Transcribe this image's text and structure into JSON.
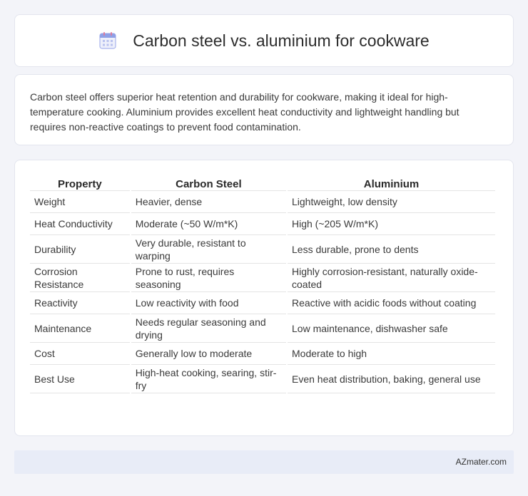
{
  "header": {
    "title": "Carbon steel vs. aluminium for cookware",
    "icon": "calendar-icon"
  },
  "summary": {
    "text": "Carbon steel offers superior heat retention and durability for cookware, making it ideal for high-temperature cooking. Aluminium provides excellent heat conductivity and lightweight handling but requires non-reactive coatings to prevent food contamination."
  },
  "table": {
    "headers": [
      "Property",
      "Carbon Steel",
      "Aluminium"
    ],
    "rows": [
      [
        "Weight",
        "Heavier, dense",
        "Lightweight, low density"
      ],
      [
        "Heat Conductivity",
        "Moderate (~50 W/m*K)",
        "High (~205 W/m*K)"
      ],
      [
        "Durability",
        "Very durable, resistant to warping",
        "Less durable, prone to dents"
      ],
      [
        "Corrosion Resistance",
        "Prone to rust, requires seasoning",
        "Highly corrosion-resistant, naturally oxide-coated"
      ],
      [
        "Reactivity",
        "Low reactivity with food",
        "Reactive with acidic foods without coating"
      ],
      [
        "Maintenance",
        "Needs regular seasoning and drying",
        "Low maintenance, dishwasher safe"
      ],
      [
        "Cost",
        "Generally low to moderate",
        "Moderate to high"
      ],
      [
        "Best Use",
        "High-heat cooking, searing, stir-fry",
        "Even heat distribution, baking, general use"
      ]
    ]
  },
  "footer": {
    "brand": "AZmater.com"
  },
  "colors": {
    "background": "#f3f4f9",
    "card": "#ffffff",
    "footer_bg": "#e8ecf7",
    "icon_accent": "#7b8fe0"
  }
}
